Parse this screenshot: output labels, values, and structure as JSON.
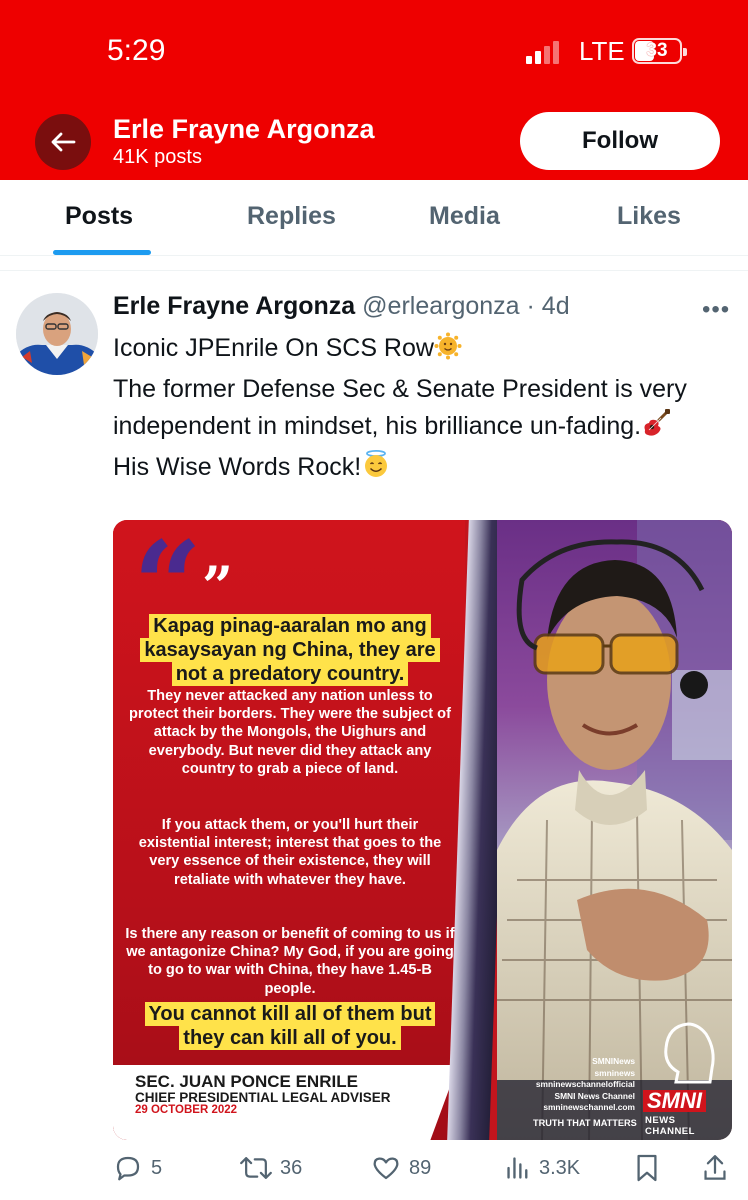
{
  "status_bar": {
    "time": "5:29",
    "network": "LTE",
    "battery": "33"
  },
  "header": {
    "name": "Erle Frayne Argonza",
    "post_count": "41K posts",
    "follow_label": "Follow"
  },
  "tabs": [
    {
      "label": "Posts",
      "active": true
    },
    {
      "label": "Replies",
      "active": false
    },
    {
      "label": "Media",
      "active": false
    },
    {
      "label": "Likes",
      "active": false
    }
  ],
  "post": {
    "author_name": "Erle Frayne Argonza",
    "handle": "@erleargonza",
    "time_ago": "· 4d",
    "more": "•••",
    "lines": [
      "Iconic JPEnrile On SCS Row",
      "The former Defense Sec & Senate President is very independent in mindset, his brilliance un-fading.",
      "His Wise Words Rock!"
    ],
    "emojis": [
      "sun-with-face-emoji",
      "guitar-emoji",
      "smiling-face-with-halo-emoji"
    ],
    "media": {
      "headline": "Kapag pinag-aaralan mo ang kasaysayan ng China, they are not a predatory country.",
      "para1": "They never attacked any nation unless to protect their borders. They were the subject of attack by the Mongols, the Uighurs and everybody. But never did they attack any country to grab a piece of land.",
      "para2": "If you attack them, or you'll hurt their existential interest; interest that goes to the very essence of their existence, they will retaliate with whatever they have.",
      "para3": "Is there any reason or benefit of coming to us if we antagonize China? My God, if you are going to go to war with China, they have 1.45-B people.",
      "closing": "You cannot kill all of them but they can kill all of you.",
      "speaker_name": "SEC. JUAN PONCE ENRILE",
      "speaker_title": "CHIEF PRESIDENTIAL LEGAL ADVISER",
      "date": "29 OCTOBER 2022",
      "socials": [
        "SMNINews",
        "smninews",
        "smninewschannelofficial",
        "SMNI News Channel",
        "smninewschannel.com"
      ],
      "brand": "SMNI",
      "brand_sub": "NEWS CHANNEL",
      "tagline": "TRUTH THAT MATTERS"
    },
    "stats": {
      "replies": "5",
      "reposts": "36",
      "likes": "89",
      "views": "3.3K"
    }
  },
  "colors": {
    "header_red": "#ee0000",
    "accent_blue": "#1d9bf0",
    "muted_text": "#536471"
  }
}
